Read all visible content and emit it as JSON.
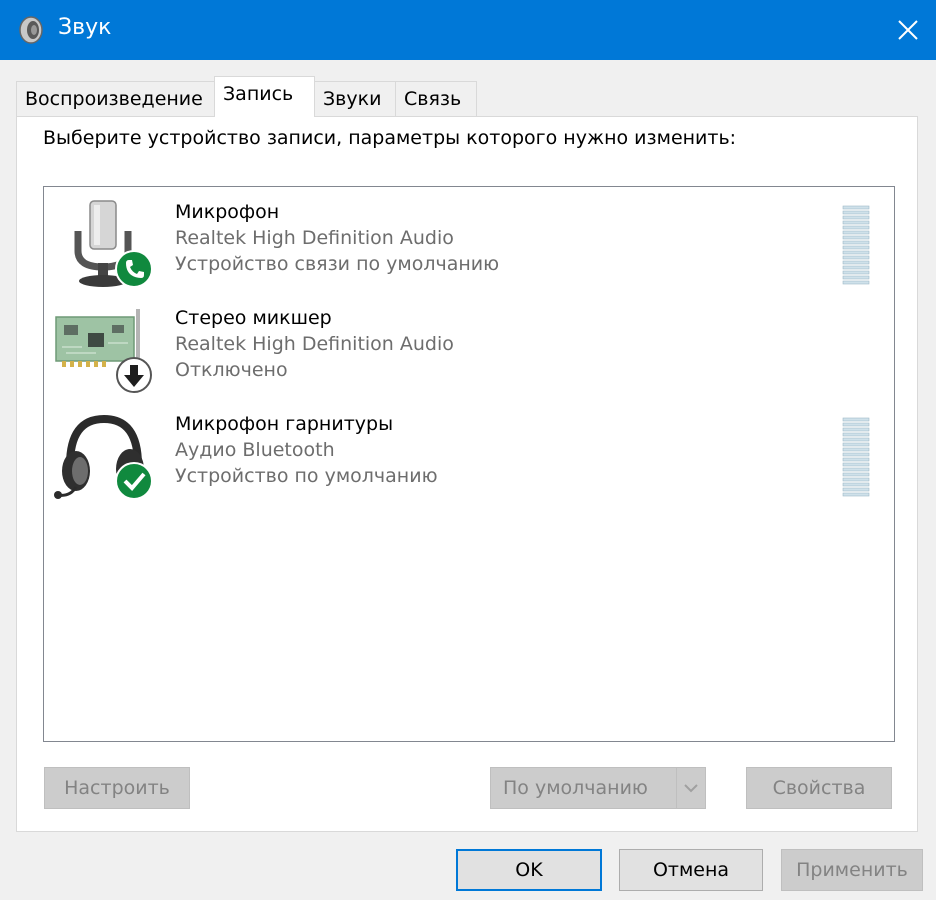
{
  "window": {
    "title": "Звук"
  },
  "tabs": [
    {
      "label": "Воспроизведение"
    },
    {
      "label": "Запись"
    },
    {
      "label": "Звуки"
    },
    {
      "label": "Связь"
    }
  ],
  "instruction": "Выберите устройство записи, параметры которого нужно изменить:",
  "devices": [
    {
      "name": "Микрофон",
      "driver": "Realtek High Definition Audio",
      "status": "Устройство связи по умолчанию",
      "icon": "microphone-icon",
      "badge": "phone-badge-icon"
    },
    {
      "name": "Стерео микшер",
      "driver": "Realtek High Definition Audio",
      "status": "Отключено",
      "icon": "sound-card-icon",
      "badge": "disabled-arrow-badge-icon"
    },
    {
      "name": "Микрофон гарнитуры",
      "driver": "Аудио Bluetooth",
      "status": "Устройство по умолчанию",
      "icon": "headset-icon",
      "badge": "checkmark-badge-icon"
    }
  ],
  "buttons": {
    "configure": "Настроить",
    "set_default": "По умолчанию",
    "properties": "Свойства",
    "ok": "OK",
    "cancel": "Отмена",
    "apply": "Применить"
  },
  "colors": {
    "titlebar": "#0078d7",
    "badge_green": "#10893e",
    "disabled_text": "#838383"
  }
}
